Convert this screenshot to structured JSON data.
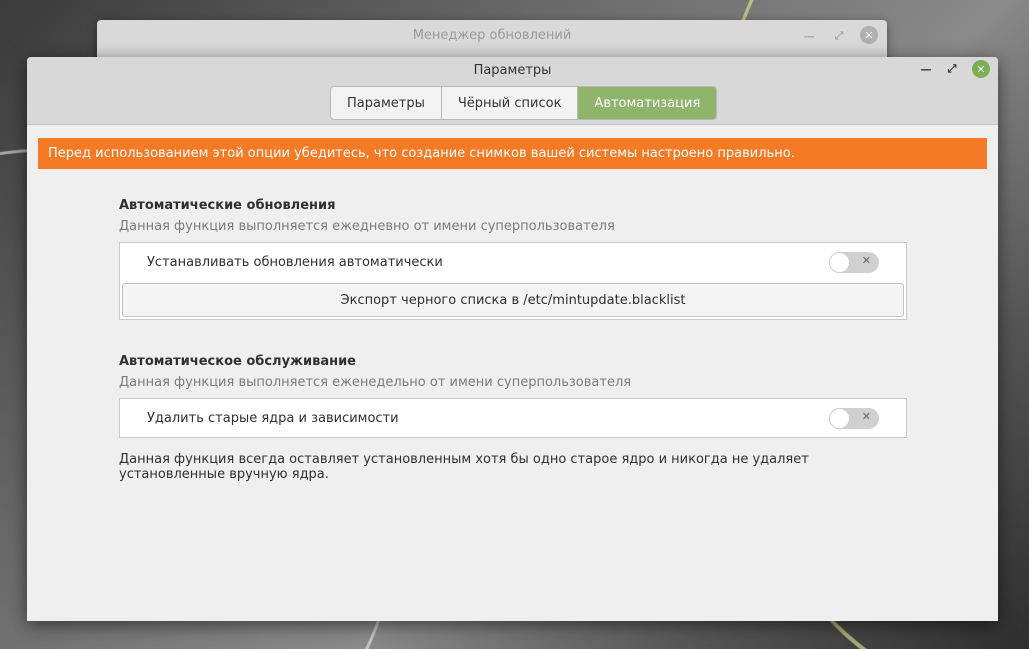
{
  "background_window": {
    "title": "Менеджер обновлений"
  },
  "window": {
    "title": "Параметры"
  },
  "tabs": [
    {
      "label": "Параметры"
    },
    {
      "label": "Чёрный список"
    },
    {
      "label": "Автоматизация"
    }
  ],
  "banner": "Перед использованием этой опции убедитесь, что создание снимков вашей системы настроено правильно.",
  "auto_updates": {
    "heading": "Автоматические обновления",
    "subtitle": "Данная функция выполняется ежедневно от имени суперпользователя",
    "toggle_label": "Устанавливать обновления автоматически",
    "toggle_on": false,
    "export_button": "Экспорт черного списка в /etc/mintupdate.blacklist"
  },
  "auto_maintenance": {
    "heading": "Автоматическое обслуживание",
    "subtitle": "Данная функция выполняется еженедельно от имени суперпользователя",
    "toggle_label": "Удалить старые ядра и зависимости",
    "toggle_on": false,
    "note": "Данная функция всегда оставляет установленным хотя бы одно старое ядро и никогда не удаляет установленные вручную ядра."
  },
  "colors": {
    "accent": "#8fb46c",
    "banner": "#f47a26",
    "close": "#7cae56"
  }
}
